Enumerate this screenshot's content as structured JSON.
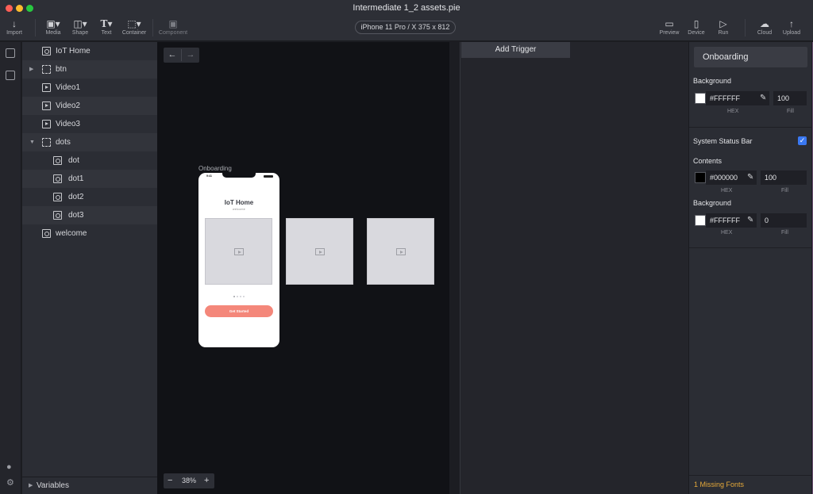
{
  "window": {
    "title": "Intermediate 1_2 assets.pie"
  },
  "toolbar": {
    "import": "Import",
    "media": "Media",
    "shape": "Shape",
    "text": "Text",
    "container": "Container",
    "component": "Component",
    "device": "iPhone 11 Pro / X  375 x 812",
    "preview": "Preview",
    "device_btn": "Device",
    "run": "Run",
    "cloud": "Cloud",
    "upload": "Upload"
  },
  "layers": {
    "items": [
      {
        "label": "IoT Home",
        "icon": "image-layer-icon"
      },
      {
        "label": "btn",
        "icon": "container-layer-icon"
      },
      {
        "label": "Video1",
        "icon": "video-layer-icon"
      },
      {
        "label": "Video2",
        "icon": "video-layer-icon"
      },
      {
        "label": "Video3",
        "icon": "video-layer-icon"
      },
      {
        "label": "dots",
        "icon": "container-layer-icon"
      },
      {
        "label": "dot",
        "icon": "image-layer-icon"
      },
      {
        "label": "dot1",
        "icon": "image-layer-icon"
      },
      {
        "label": "dot2",
        "icon": "image-layer-icon"
      },
      {
        "label": "dot3",
        "icon": "image-layer-icon"
      },
      {
        "label": "welcome",
        "icon": "image-layer-icon"
      }
    ],
    "variables": "Variables"
  },
  "canvas": {
    "artboard_label": "Onboarding",
    "phone_time": "9:41",
    "phone_title": "IoT Home",
    "phone_subtitle": "welcome",
    "cta": "Get Started",
    "zoom": "38%"
  },
  "triggers": {
    "add_trigger": "Add Trigger"
  },
  "props": {
    "name": "Onboarding",
    "background_label": "Background",
    "bg_hex": "#FFFFFF",
    "bg_fill": "100",
    "hex_label": "HEX",
    "fill_label": "Fill",
    "status_bar_label": "System Status Bar",
    "status_bar_checked": true,
    "contents_label": "Contents",
    "contents_hex": "#000000",
    "contents_fill": "100",
    "sb_background_label": "Background",
    "sb_bg_hex": "#FFFFFF",
    "sb_bg_fill": "0",
    "missing_fonts": "1 Missing Fonts"
  },
  "colors": {
    "accent": "#3a78f2",
    "cta": "#f4877a",
    "warning": "#e4a83a"
  }
}
